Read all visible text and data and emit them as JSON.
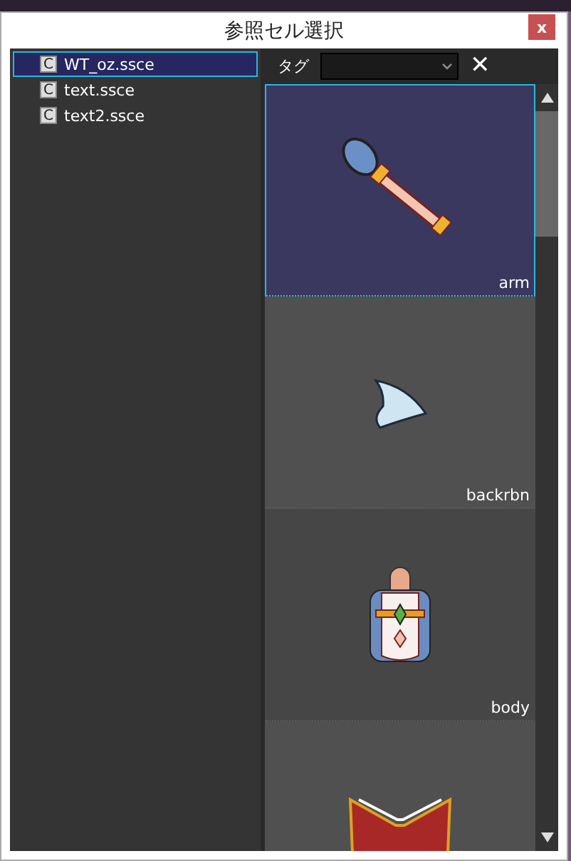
{
  "window": {
    "title": "参照セル選択",
    "close_label": "x"
  },
  "files": [
    {
      "icon_letter": "C",
      "name": "WT_oz.ssce",
      "selected": true
    },
    {
      "icon_letter": "C",
      "name": "text.ssce",
      "selected": false
    },
    {
      "icon_letter": "C",
      "name": "text2.ssce",
      "selected": false
    }
  ],
  "tag_filter": {
    "label": "タグ",
    "clear_label": "✕"
  },
  "cells": [
    {
      "kind": "wand",
      "label": "arm",
      "selected": true
    },
    {
      "kind": "ribbon",
      "label": "backrbn",
      "selected": false
    },
    {
      "kind": "body",
      "label": "body",
      "selected": false
    },
    {
      "kind": "book",
      "selected": false
    }
  ]
}
